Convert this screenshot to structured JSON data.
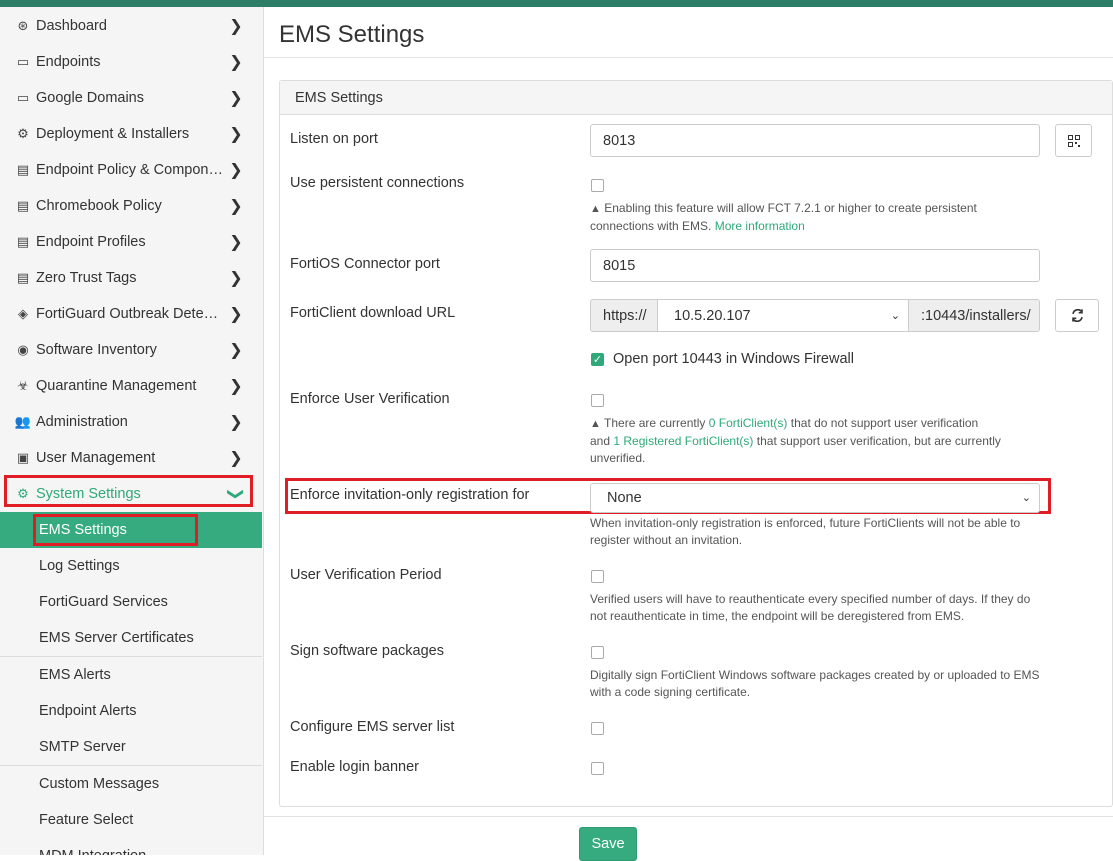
{
  "sidebar": {
    "items": [
      {
        "label": "Dashboard",
        "icon": "dashboard-icon",
        "glyph": "⊛"
      },
      {
        "label": "Endpoints",
        "icon": "laptop-icon",
        "glyph": "▭"
      },
      {
        "label": "Google Domains",
        "icon": "laptop-icon",
        "glyph": "▭"
      },
      {
        "label": "Deployment & Installers",
        "icon": "gear-cog-icon",
        "glyph": "⚙"
      },
      {
        "label": "Endpoint Policy & Components",
        "icon": "document-icon",
        "glyph": "▤"
      },
      {
        "label": "Chromebook Policy",
        "icon": "document-icon",
        "glyph": "▤"
      },
      {
        "label": "Endpoint Profiles",
        "icon": "profile-icon",
        "glyph": "▤"
      },
      {
        "label": "Zero Trust Tags",
        "icon": "tag-list-icon",
        "glyph": "▤"
      },
      {
        "label": "FortiGuard Outbreak Detecti…",
        "icon": "shield-icon",
        "glyph": "◈"
      },
      {
        "label": "Software Inventory",
        "icon": "package-icon",
        "glyph": "◉"
      },
      {
        "label": "Quarantine Management",
        "icon": "biohazard-icon",
        "glyph": "☣"
      },
      {
        "label": "Administration",
        "icon": "users-icon",
        "glyph": "👥"
      },
      {
        "label": "User Management",
        "icon": "id-card-icon",
        "glyph": "▣"
      },
      {
        "label": "System Settings",
        "icon": "gear-icon",
        "glyph": "⚙"
      }
    ],
    "sub_items": [
      "EMS Settings",
      "Log Settings",
      "FortiGuard Services",
      "EMS Server Certificates",
      "EMS Alerts",
      "Endpoint Alerts",
      "SMTP Server",
      "Custom Messages",
      "Feature Select",
      "MDM Integration"
    ],
    "chevron_right": "❯",
    "chevron_down": "❯"
  },
  "main": {
    "title": "EMS Settings",
    "panel_title": "EMS Settings",
    "listen_port": {
      "label": "Listen on port",
      "value": "8013"
    },
    "persistent": {
      "label": "Use persistent connections",
      "help_1": "Enabling this feature will allow FCT 7.2.1 or higher to create persistent",
      "help_2": "connections with EMS.",
      "link": "More information"
    },
    "fortios_port": {
      "label": "FortiOS Connector port",
      "value": "8015"
    },
    "download_url": {
      "label": "FortiClient download URL",
      "prefix": "https://",
      "host": "10.5.20.107",
      "suffix": ":10443/installers/"
    },
    "open_port": {
      "label": "Open port 10443 in Windows Firewall",
      "checked": true
    },
    "user_verification": {
      "label": "Enforce User Verification",
      "help_a": "There are currently",
      "link_a": "0 FortiClient(s)",
      "help_b": "that do not support user verification",
      "help_c": "and",
      "link_b": "1 Registered FortiClient(s)",
      "help_d": "that support user verification, but are currently",
      "help_e": "unverified."
    },
    "invitation": {
      "label": "Enforce invitation-only registration for",
      "value": "None",
      "help_1": "When invitation-only registration is enforced, future FortiClients will not be able to",
      "help_2": "register without an invitation."
    },
    "verification_period": {
      "label": "User Verification Period",
      "help_1": "Verified users will have to reauthenticate every specified number of days. If they do",
      "help_2": "not reauthenticate in time, the endpoint will be deregistered from EMS."
    },
    "sign_packages": {
      "label": "Sign software packages",
      "help_1": "Digitally sign FortiClient Windows software packages created by or uploaded to EMS",
      "help_2": "with a code signing certificate."
    },
    "server_list": {
      "label": "Configure EMS server list"
    },
    "login_banner": {
      "label": "Enable login banner"
    },
    "save_label": "Save"
  },
  "colors": {
    "accent": "#36ab7f",
    "highlight": "#e01c24",
    "topbar": "#2e7d66"
  }
}
